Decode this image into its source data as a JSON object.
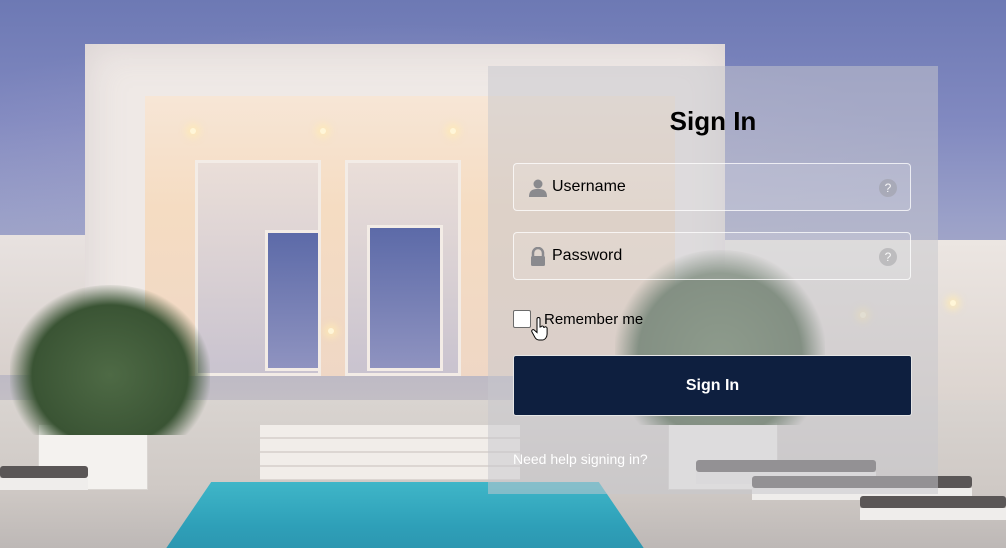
{
  "login": {
    "title": "Sign In",
    "username": {
      "placeholder": "Username",
      "leading_icon": "user-icon",
      "trailing_icon": "help-icon"
    },
    "password": {
      "placeholder": "Password",
      "leading_icon": "lock-icon",
      "trailing_icon": "help-icon"
    },
    "remember": {
      "label": "Remember me",
      "checked": false
    },
    "submit_label": "Sign In",
    "help_link": "Need help signing in?"
  },
  "colors": {
    "button_bg": "#0e1f3f",
    "panel_bg": "rgba(200,200,205,0.52)",
    "text": "#000000",
    "link": "#ffffff"
  }
}
